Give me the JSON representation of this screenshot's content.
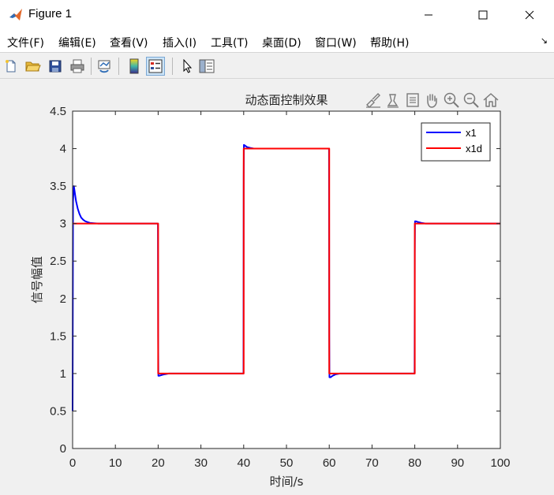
{
  "window": {
    "title": "Figure 1",
    "controls": [
      "minimize",
      "maximize",
      "close"
    ]
  },
  "menu": {
    "items": [
      "文件(F)",
      "编辑(E)",
      "查看(V)",
      "插入(I)",
      "工具(T)",
      "桌面(D)",
      "窗口(W)",
      "帮助(H)"
    ],
    "overflow_arrow": "↘"
  },
  "toolbar": {
    "icons": [
      "new-figure-icon",
      "open-file-icon",
      "save-icon",
      "print-icon",
      "link-plot-icon",
      "colorbar-icon",
      "legend-icon",
      "pointer-icon",
      "property-inspector-icon"
    ],
    "active": "legend-icon"
  },
  "axes_toolbar": {
    "icons": [
      "brush-icon",
      "data-tips-icon",
      "rotate-icon",
      "pan-icon",
      "zoom-in-icon",
      "zoom-out-icon",
      "home-icon"
    ]
  },
  "colors": {
    "x1": "#0000ff",
    "x1d": "#ff0000",
    "plot_background": "#ffffff",
    "figure_background": "#f0f0f0"
  },
  "chart_data": {
    "type": "line",
    "title": "动态面控制效果",
    "xlabel": "时间/s",
    "ylabel": "信号幅值",
    "xlim": [
      0,
      100
    ],
    "ylim": [
      0,
      4.5
    ],
    "xticks": [
      0,
      10,
      20,
      30,
      40,
      50,
      60,
      70,
      80,
      90,
      100
    ],
    "yticks": [
      0,
      0.5,
      1,
      1.5,
      2,
      2.5,
      3,
      3.5,
      4,
      4.5
    ],
    "xtick_labels": [
      "0",
      "10",
      "20",
      "30",
      "40",
      "50",
      "60",
      "70",
      "80",
      "90",
      "100"
    ],
    "ytick_labels": [
      "0",
      "0.5",
      "1",
      "1.5",
      "2",
      "2.5",
      "3",
      "3.5",
      "4",
      "4.5"
    ],
    "grid": false,
    "legend_position": "top-right",
    "series": [
      {
        "name": "x1",
        "x": [
          0,
          0.1,
          0.3,
          0.5,
          0.8,
          1.2,
          1.6,
          2,
          2.5,
          3,
          4,
          5,
          6,
          8,
          10,
          15,
          19.95,
          20,
          20.05,
          20.3,
          20.8,
          21.5,
          22.5,
          25,
          30,
          39.95,
          40,
          40.05,
          40.3,
          40.8,
          41.5,
          42.5,
          45,
          50,
          59.95,
          60,
          60.05,
          60.3,
          60.8,
          61.5,
          62.5,
          65,
          70,
          79.95,
          80,
          80.05,
          80.3,
          80.8,
          81.5,
          82.5,
          85,
          90,
          100
        ],
        "y": [
          0.5,
          3.3,
          3.5,
          3.42,
          3.3,
          3.2,
          3.13,
          3.08,
          3.05,
          3.03,
          3.01,
          3.005,
          3.0,
          3.0,
          3.0,
          3.0,
          3.0,
          1.5,
          0.97,
          0.97,
          0.98,
          0.99,
          1.0,
          1.0,
          1.0,
          1.0,
          3.6,
          4.05,
          4.04,
          4.02,
          4.01,
          4.0,
          4.0,
          4.0,
          4.0,
          1.5,
          0.95,
          0.95,
          0.97,
          0.99,
          1.0,
          1.0,
          1.0,
          1.0,
          2.6,
          3.03,
          3.03,
          3.02,
          3.01,
          3.0,
          3.0,
          3.0,
          3.0
        ]
      },
      {
        "name": "x1d",
        "x": [
          0,
          20,
          20,
          40,
          40,
          60,
          60,
          80,
          80,
          100
        ],
        "y": [
          3,
          3,
          1,
          1,
          4,
          4,
          1,
          1,
          3,
          3
        ]
      }
    ]
  }
}
